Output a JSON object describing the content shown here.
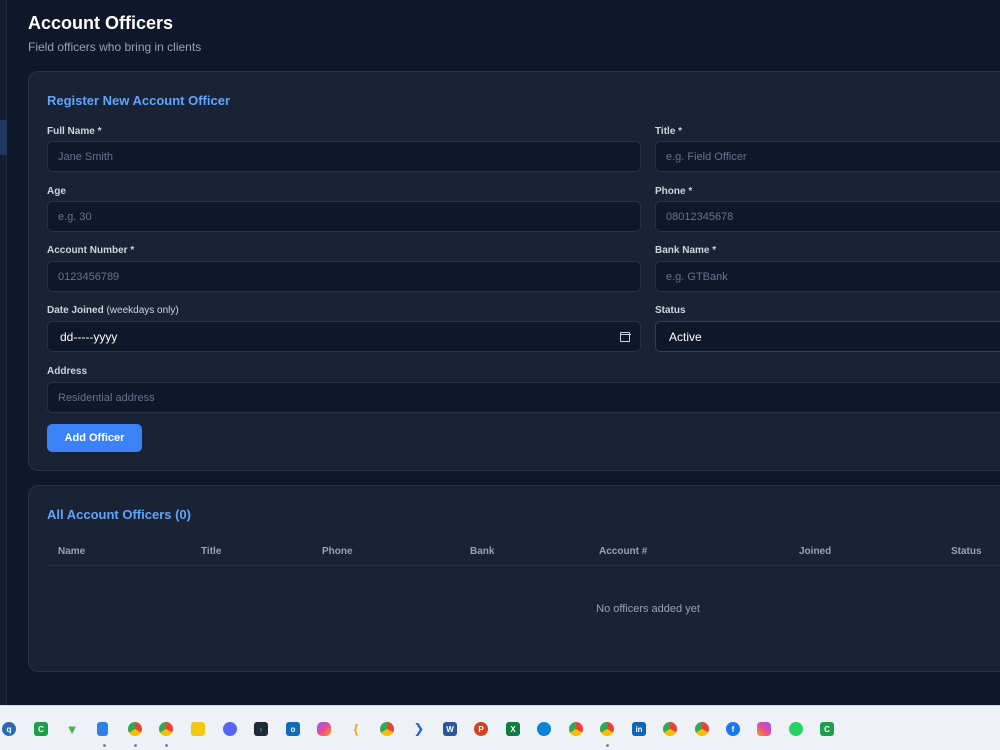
{
  "page": {
    "title": "Account Officers",
    "subtitle": "Field officers who bring in clients"
  },
  "form": {
    "title": "Register New Account Officer",
    "full_name": {
      "label": "Full Name *",
      "placeholder": "Jane Smith"
    },
    "title_field": {
      "label": "Title *",
      "placeholder": "e.g. Field Officer"
    },
    "age": {
      "label": "Age",
      "placeholder": "e.g. 30"
    },
    "phone": {
      "label": "Phone *",
      "placeholder": "08012345678"
    },
    "account_number": {
      "label": "Account Number *",
      "placeholder": "0123456789"
    },
    "bank_name": {
      "label": "Bank Name *",
      "placeholder": "e.g. GTBank"
    },
    "date_joined": {
      "label": "Date Joined",
      "hint": "(weekdays only)",
      "value": "dd-----yyyy"
    },
    "status": {
      "label": "Status",
      "value": "Active"
    },
    "address": {
      "label": "Address",
      "placeholder": "Residential address"
    },
    "submit_label": "Add Officer"
  },
  "table": {
    "title": "All Account Officers (0)",
    "columns": [
      "Name",
      "Title",
      "Phone",
      "Bank",
      "Account #",
      "Joined",
      "Status"
    ],
    "empty_message": "No officers added yet"
  },
  "taskbar": {
    "icons": [
      "qbittorrent-icon",
      "camtasia-icon",
      "download-icon",
      "notepad-icon",
      "chrome-icon",
      "chrome-icon",
      "power-bi-icon",
      "discord-icon",
      "terminal-icon",
      "outlook-icon",
      "copilot-icon",
      "bracket-icon",
      "chrome-icon",
      "power-automate-icon",
      "word-icon",
      "powerpoint-icon",
      "excel-icon",
      "edge-icon",
      "chrome-icon",
      "chrome-icon",
      "linkedin-icon",
      "chrome-icon",
      "chrome-icon",
      "facebook-icon",
      "instagram-icon",
      "whatsapp-icon",
      "camtasia-icon"
    ]
  }
}
